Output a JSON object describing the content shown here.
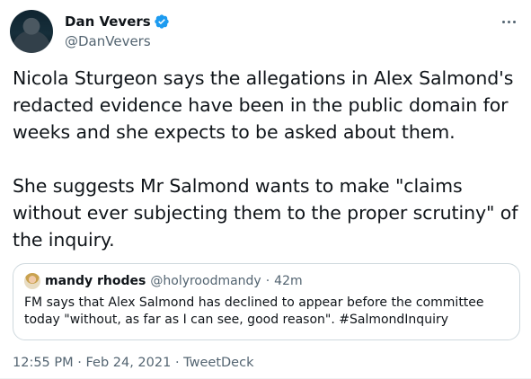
{
  "author": {
    "display_name": "Dan Vevers",
    "handle": "@DanVevers",
    "verified": true
  },
  "tweet": {
    "paragraphs": [
      "Nicola Sturgeon says the allegations in Alex Salmond's redacted evidence have been in the public domain for weeks and she expects to be asked about them.",
      "She suggests Mr Salmond wants to make \"claims without ever subjecting them to the proper scrutiny\" of the inquiry."
    ]
  },
  "quote": {
    "display_name": "mandy rhodes",
    "handle": "@holyroodmandy",
    "separator": "·",
    "time": "42m",
    "text": "FM says that Alex Salmond has declined to appear before the committee today \"without, as far as I can see, good reason\". #SalmondInquiry"
  },
  "meta": {
    "time": "12:55 PM",
    "separator_1": "·",
    "date": "Feb 24, 2021",
    "separator_2": "·",
    "source": "TweetDeck"
  },
  "icons": {
    "verified": "verified-badge-icon",
    "more": "more-options-icon"
  },
  "colors": {
    "accent": "#1d9bf0",
    "text": "#0f1419",
    "secondary": "#536471",
    "border": "#cfd9de"
  }
}
